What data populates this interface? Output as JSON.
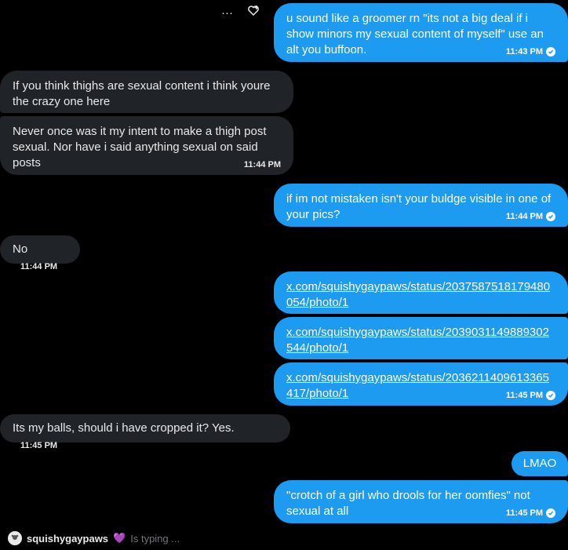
{
  "messages": [
    {
      "id": "m1",
      "side": "sent",
      "text": "u sound like a groomer rn \"its not a big deal if i show minors my sexual content of myself\" use an alt you buffoon.",
      "time": "11:43 PM",
      "read": true
    },
    {
      "id": "m2",
      "side": "received",
      "text": "If you think thighs are sexual content i think youre the crazy one here"
    },
    {
      "id": "m3",
      "side": "received",
      "text": "Never once was it my intent to make a thigh post sexual. Nor have i said anything sexual on said posts",
      "time": "11:44 PM"
    },
    {
      "id": "m4",
      "side": "sent",
      "text": "if im not mistaken isn't your buldge visible in one of your pics?",
      "time": "11:44 PM",
      "read": true
    },
    {
      "id": "m5",
      "side": "received",
      "text": "No",
      "time": "11:44 PM"
    },
    {
      "id": "m6",
      "side": "sent",
      "link": "x.com/squishygaypaws/status/2037587518179480054/photo/1"
    },
    {
      "id": "m7",
      "side": "sent",
      "link": "x.com/squishygaypaws/status/2039031149889302544/photo/1"
    },
    {
      "id": "m8",
      "side": "sent",
      "link": "x.com/squishygaypaws/status/2036211409613365417/photo/1",
      "time": "11:45 PM",
      "read": true
    },
    {
      "id": "m9",
      "side": "received",
      "text": "Its my balls, should i have cropped it? Yes.",
      "time": "11:45 PM"
    },
    {
      "id": "m10",
      "side": "sent",
      "text": "LMAO"
    },
    {
      "id": "m11",
      "side": "sent",
      "text": "\"crotch of a girl who drools for her oomfies\" not sexual at all",
      "time": "11:45 PM",
      "read": true
    }
  ],
  "hover_actions": {
    "more": "···",
    "react": "♡"
  },
  "typing": {
    "username": "squishygaypaws",
    "heart": "💜",
    "status": "Is typing ..."
  },
  "colors": {
    "sent_bubble": "#1d9bf0",
    "received_bubble": "#202327",
    "background": "#000000"
  }
}
